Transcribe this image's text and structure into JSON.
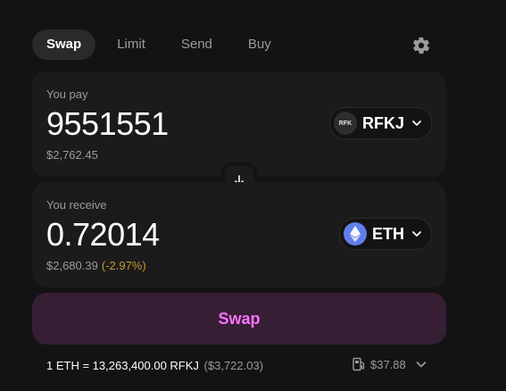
{
  "tabs": [
    {
      "label": "Swap",
      "active": true
    },
    {
      "label": "Limit",
      "active": false
    },
    {
      "label": "Send",
      "active": false
    },
    {
      "label": "Buy",
      "active": false
    }
  ],
  "settings_icon": "gear-icon",
  "pay": {
    "label": "You pay",
    "amount": "9551551",
    "usd_value": "$2,762.45",
    "token": {
      "symbol": "RFKJ",
      "logo_text": "RFK"
    }
  },
  "receive": {
    "label": "You receive",
    "amount": "0.72014",
    "usd_value": "$2,680.39",
    "price_impact": "(-2.97%)",
    "token": {
      "symbol": "ETH",
      "logo_icon": "ethereum-icon"
    }
  },
  "switch_icon": "arrow-down-icon",
  "swap_button": {
    "label": "Swap"
  },
  "rate": {
    "text": "1 ETH = 13,263,400.00 RFKJ",
    "usd": "($3,722.03)"
  },
  "gas": {
    "value": "$37.88",
    "icon": "gas-pump-icon"
  },
  "colors": {
    "background": "#131313",
    "panel": "#1b1b1b",
    "swap_button_bg": "#361e35",
    "swap_button_text": "#fc72ff",
    "price_impact": "#c99a2e",
    "eth": "#627eea"
  }
}
